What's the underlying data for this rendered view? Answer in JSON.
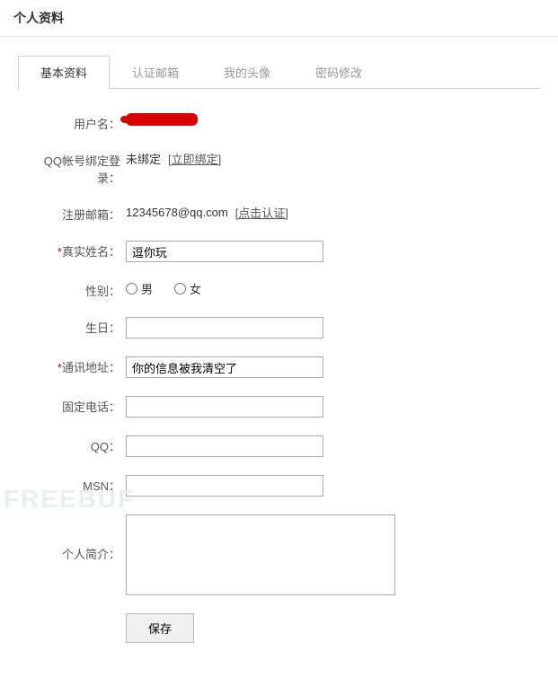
{
  "page": {
    "title": "个人资料"
  },
  "tabs": {
    "basic": "基本资料",
    "email": "认证邮箱",
    "avatar": "我的头像",
    "password": "密码修改"
  },
  "labels": {
    "username": "用户名：",
    "qqLogin": "QQ帐号绑定登录：",
    "regEmail": "注册邮箱：",
    "realName": "真实姓名：",
    "gender": "性别：",
    "birthday": "生日：",
    "address": "通讯地址：",
    "phone": "固定电话：",
    "qq": "QQ：",
    "msn": "MSN：",
    "bio": "个人简介："
  },
  "values": {
    "qqBindStatus": "未绑定",
    "qqBindAction": "[立即绑定]",
    "regEmail": "12345678@qq.com",
    "regEmailAction": "[点击认证]",
    "realName": "逗你玩",
    "genderMale": "男",
    "genderFemale": "女",
    "birthday": "",
    "address": "你的信息被我清空了",
    "phone": "",
    "qq": "",
    "msn": "",
    "bio": ""
  },
  "buttons": {
    "save": "保存"
  },
  "watermark": "FREEBUF"
}
